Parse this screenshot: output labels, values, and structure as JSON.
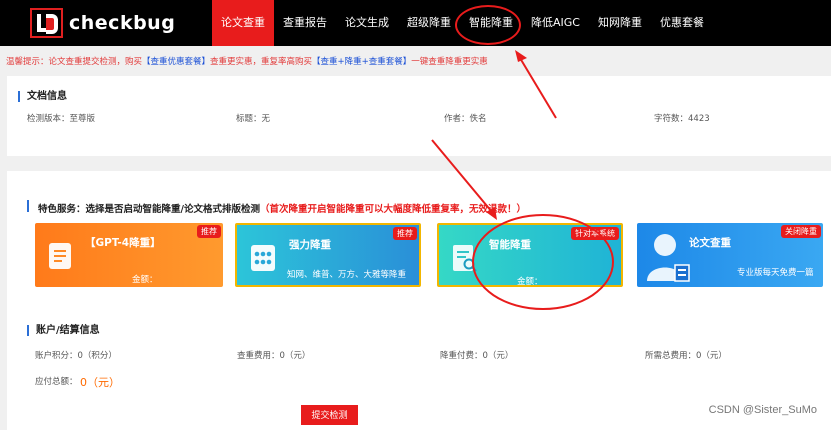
{
  "brand": {
    "name": "checkbug"
  },
  "nav": {
    "items": [
      {
        "label": "论文查重",
        "active": true
      },
      {
        "label": "查重报告",
        "active": false
      },
      {
        "label": "论文生成",
        "active": false
      },
      {
        "label": "超级降重",
        "active": false
      },
      {
        "label": "智能降重",
        "active": false
      },
      {
        "label": "降低AIGC",
        "active": false
      },
      {
        "label": "知网降重",
        "active": false
      },
      {
        "label": "优惠套餐",
        "active": false
      }
    ]
  },
  "notice": {
    "prefix": "温馨提示：论文查重提交检测，购买",
    "link1": "【查重优惠套餐】",
    "mid": "查重更实惠，重复率高购买",
    "link2": "【查重+降重+查重套餐】",
    "suffix": "一键查重降重更实惠"
  },
  "doc_info": {
    "title": "文档信息",
    "version": "检测版本：至尊版",
    "doc_title": "标题：无",
    "author": "作者：佚名",
    "char_count": "字符数：4423"
  },
  "features": {
    "title_prefix": "特色服务：",
    "title_main": "选择是否启动智能降重/论文格式排版检测",
    "title_warning": "（首次降重开启智能降重可以大幅度降低重复率，无效退款！）",
    "cards": [
      {
        "title": "【GPT-4降重】",
        "sub": "",
        "price": "金额：",
        "badge": "推荐",
        "icon": "document-edit-icon"
      },
      {
        "title": "强力降重",
        "sub": "知网、维普、万方、大雅等降重",
        "price": "",
        "badge": "推荐",
        "icon": "grid-apps-icon"
      },
      {
        "title": "智能降重",
        "sub": "",
        "price": "金额：",
        "badge": "针对本系统",
        "icon": "report-search-icon"
      },
      {
        "title": "论文查重",
        "sub": "专业版每天免费一篇",
        "price": "",
        "badge": "关闭降重",
        "icon": "person-doc-icon"
      }
    ]
  },
  "billing": {
    "title": "账户/结算信息",
    "points": "账户积分：0（积分）",
    "check_fee": "查重费用：0（元）",
    "reduce_fee": "降重付费：0（元）",
    "total_needed": "所需总费用：0（元）",
    "due_label": "应付总额：",
    "due_value": "0（元）"
  },
  "submit": {
    "label": "提交检测"
  },
  "watermark": "CSDN @Sister_SuMo",
  "colors": {
    "accent": "#e81c1c",
    "nav_bg": "#000000",
    "link_blue": "#1a4fd6",
    "price_orange": "#ff6a00"
  }
}
